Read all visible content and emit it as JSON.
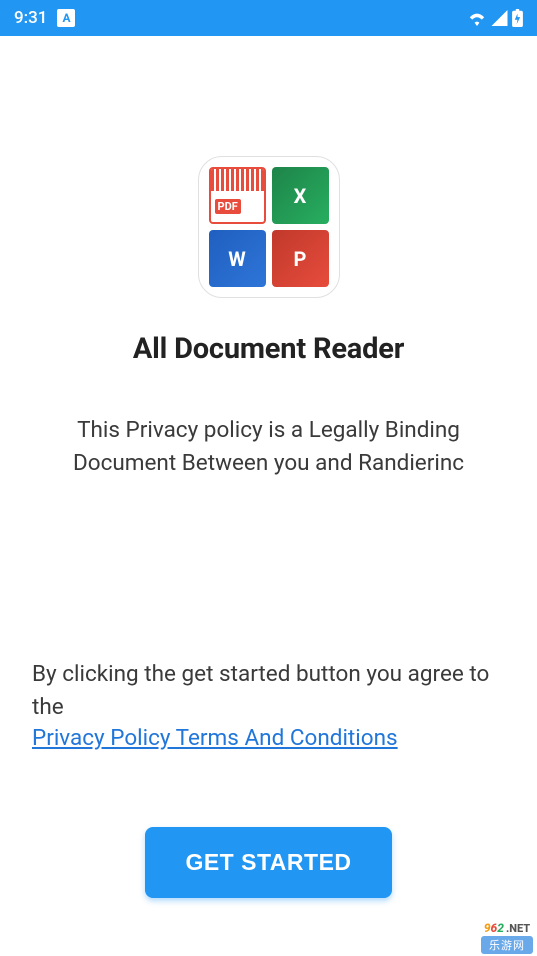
{
  "status_bar": {
    "time": "9:31",
    "left_indicator": "A"
  },
  "hero": {
    "title": "All Document Reader",
    "description": "This Privacy policy is a Legally Binding Document Between you and Randierinc",
    "icon_tiles": {
      "pdf": "PDF",
      "xls": "X",
      "doc": "W",
      "ppt": "P"
    }
  },
  "agreement": {
    "prefix": "By clicking the get started button you agree to the",
    "link_text": "Privacy Policy Terms And Conditions"
  },
  "cta": {
    "label": "GET STARTED"
  },
  "watermark": {
    "digits": "962",
    "suffix": ".NET",
    "sub": "乐游网"
  }
}
